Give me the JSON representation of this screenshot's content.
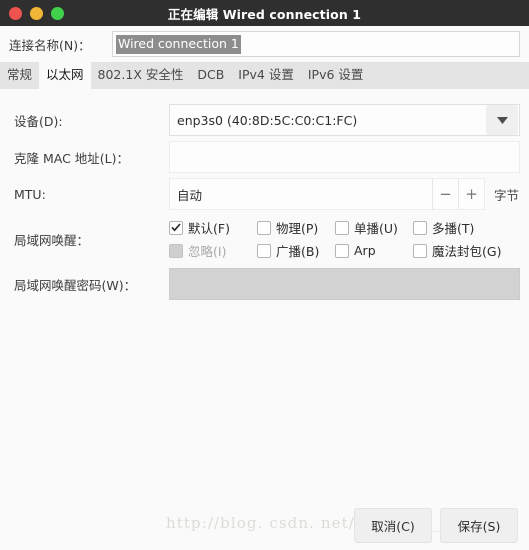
{
  "window": {
    "title": "正在编辑 Wired connection 1",
    "controls": {
      "close": "close-button",
      "minimize": "minimize-button",
      "maximize": "maximize-button"
    },
    "colors": {
      "titlebar_bg": "#2f2f2f",
      "close": "#ef5350",
      "minimize": "#f2b636",
      "maximize": "#3fd14c",
      "page_bg": "#fafafa",
      "tabbar_bg": "#e4e4e4",
      "selection": "#8d8d8d"
    }
  },
  "connection_name": {
    "label": "连接名称(N)：",
    "value": "Wired connection 1",
    "selected": true
  },
  "tabs": [
    {
      "label": "常规",
      "active": false
    },
    {
      "label": "以太网",
      "active": true
    },
    {
      "label": "802.1X 安全性",
      "active": false
    },
    {
      "label": "DCB",
      "active": false
    },
    {
      "label": "IPv4 设置",
      "active": false
    },
    {
      "label": "IPv6 设置",
      "active": false
    }
  ],
  "ethernet": {
    "device": {
      "label": "设备(D):",
      "value": "enp3s0 (40:8D:5C:C0:C1:FC)",
      "dropdown_icon": "chevron-down-icon"
    },
    "cloned_mac": {
      "label": "克隆 MAC 地址(L)：",
      "value": "",
      "placeholder": ""
    },
    "mtu": {
      "label": "MTU:",
      "value": "自动",
      "decrement": "−",
      "increment": "+",
      "units": "字节"
    },
    "wake_on_lan": {
      "label": "局域网唤醒：",
      "rows": [
        [
          {
            "label": "默认(F)",
            "checked": true,
            "enabled": true
          },
          {
            "label": "物理(P)",
            "checked": false,
            "enabled": true
          },
          {
            "label": "单播(U)",
            "checked": false,
            "enabled": true
          },
          {
            "label": "多播(T)",
            "checked": false,
            "enabled": true
          }
        ],
        [
          {
            "label": "忽略(I)",
            "checked": false,
            "enabled": false
          },
          {
            "label": "广播(B)",
            "checked": false,
            "enabled": true
          },
          {
            "label": "Arp",
            "checked": false,
            "enabled": true
          },
          {
            "label": "魔法封包(G)",
            "checked": false,
            "enabled": true
          }
        ]
      ]
    },
    "wol_password": {
      "label": "局域网唤醒密码(W)：",
      "value": "",
      "enabled": false
    }
  },
  "footer": {
    "cancel": "取消(C)",
    "save": "保存(S)",
    "watermark": "http://blog. csdn. net/xiaohong_gong"
  }
}
